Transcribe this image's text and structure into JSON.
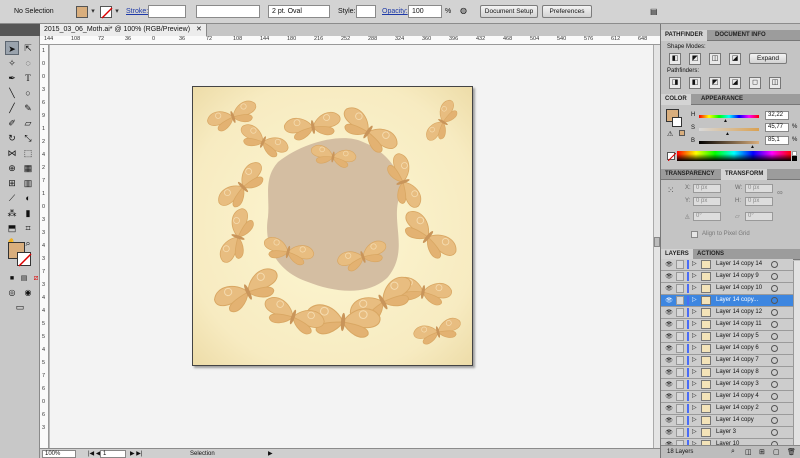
{
  "control_bar": {
    "selection_text": "No Selection",
    "fill_color": "#d9ae7d",
    "stroke_label": "Stroke:",
    "brush_value": "2 pt. Oval",
    "style_label": "Style:",
    "opacity_label": "Opacity:",
    "opacity_value": "100",
    "opacity_unit": "%",
    "document_setup_label": "Document Setup",
    "preferences_label": "Preferences"
  },
  "document_tab": {
    "title": "2015_03_06_Moth.ai* @ 100% (RGB/Preview)",
    "close_glyph": "✕"
  },
  "ruler_top_ticks": [
    "144",
    "108",
    "72",
    "36",
    "0",
    "36",
    "72",
    "108",
    "144",
    "180",
    "216",
    "252",
    "288",
    "324",
    "360",
    "396",
    "432",
    "468",
    "504",
    "540",
    "576",
    "612",
    "648"
  ],
  "ruler_left_ticks": [
    "1",
    "0",
    "0",
    "3",
    "6",
    "9",
    "1",
    "2",
    "4",
    "2",
    "7",
    "1",
    "0",
    "3",
    "3",
    "4",
    "3",
    "7",
    "3",
    "4",
    "4",
    "5",
    "5",
    "4",
    "5",
    "7",
    "6",
    "0",
    "6",
    "3"
  ],
  "status_bar": {
    "zoom": "100%",
    "artboard": "1",
    "tool": "Selection"
  },
  "pathfinder": {
    "tabs": [
      "PATHFINDER",
      "DOCUMENT INFO"
    ],
    "shape_modes_label": "Shape Modes:",
    "pathfinders_label": "Pathfinders:",
    "expand_label": "Expand"
  },
  "color_panel": {
    "tabs": [
      "COLOR",
      "APPEARANCE"
    ],
    "channels": [
      {
        "label": "H",
        "value": "32,22",
        "unit": ""
      },
      {
        "label": "S",
        "value": "45,77",
        "unit": "%"
      },
      {
        "label": "B",
        "value": "85,1",
        "unit": "%"
      }
    ]
  },
  "transform_panel": {
    "tabs": [
      "TRANSPARENCY",
      "TRANSFORM"
    ],
    "x_label": "X:",
    "y_label": "Y:",
    "w_label": "W:",
    "h_label": "H:",
    "x_value": "0 px",
    "y_value": "0 px",
    "w_value": "0 px",
    "h_value": "0 px",
    "rotate_value": "0°",
    "shear_value": "0°",
    "align_label": "Align to Pixel Grid"
  },
  "layers_panel": {
    "tabs": [
      "LAYERS",
      "ACTIONS"
    ],
    "layers": [
      {
        "name": "Layer 14 copy 14",
        "selected": false
      },
      {
        "name": "Layer 14 copy 9",
        "selected": false
      },
      {
        "name": "Layer 14 copy 10",
        "selected": false
      },
      {
        "name": "Layer 14 copy...",
        "selected": true
      },
      {
        "name": "Layer 14 copy 12",
        "selected": false
      },
      {
        "name": "Layer 14 copy 11",
        "selected": false
      },
      {
        "name": "Layer 14 copy 5",
        "selected": false
      },
      {
        "name": "Layer 14 copy 6",
        "selected": false
      },
      {
        "name": "Layer 14 copy 7",
        "selected": false
      },
      {
        "name": "Layer 14 copy 8",
        "selected": false
      },
      {
        "name": "Layer 14 copy 3",
        "selected": false
      },
      {
        "name": "Layer 14 copy 4",
        "selected": false
      },
      {
        "name": "Layer 14 copy 2",
        "selected": false
      },
      {
        "name": "Layer 14 copy",
        "selected": false
      },
      {
        "name": "Layer 3",
        "selected": false
      },
      {
        "name": "Layer 10",
        "selected": false
      }
    ],
    "count_label": "18 Layers"
  }
}
